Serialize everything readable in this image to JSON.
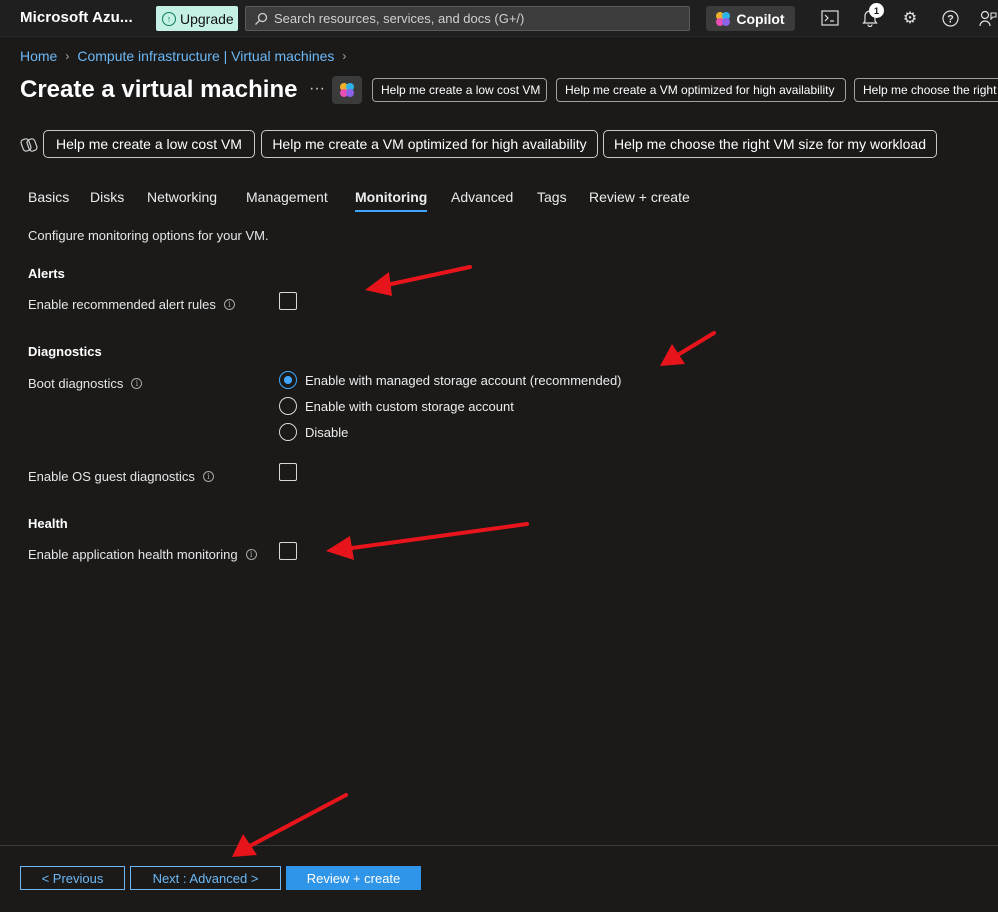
{
  "colors": {
    "background": "#1b1a19",
    "topbar": "#1f1f1f",
    "link": "#6cb8f6",
    "accent": "#3ea6ff",
    "primary_button": "#2f95e8",
    "upgrade_bg": "#c5f0e6",
    "annotation_arrow": "#e8141b"
  },
  "topbar": {
    "brand": "Microsoft Azu...",
    "upgrade_label": "Upgrade",
    "search_placeholder": "Search resources, services, and docs (G+/)",
    "copilot_label": "Copilot",
    "notification_count": "1",
    "icons": [
      "cloud-shell-icon",
      "bell-icon",
      "gear-icon",
      "help-icon",
      "feedback-icon"
    ]
  },
  "breadcrumb": {
    "items": [
      "Home",
      "Compute infrastructure | Virtual machines"
    ]
  },
  "page": {
    "title": "Create a virtual machine",
    "more": "···",
    "chips": [
      "Help me create a low cost VM",
      "Help me create a VM optimized for high availability",
      "Help me choose the right VM size for my workload"
    ]
  },
  "suggestions": [
    "Help me create a low cost VM",
    "Help me create a VM optimized for high availability",
    "Help me choose the right VM size for my workload"
  ],
  "tabs": [
    {
      "label": "Basics",
      "active": false
    },
    {
      "label": "Disks",
      "active": false
    },
    {
      "label": "Networking",
      "active": false
    },
    {
      "label": "Management",
      "active": false
    },
    {
      "label": "Monitoring",
      "active": true
    },
    {
      "label": "Advanced",
      "active": false
    },
    {
      "label": "Tags",
      "active": false
    },
    {
      "label": "Review + create",
      "active": false
    }
  ],
  "content": {
    "description": "Configure monitoring options for your VM.",
    "alerts": {
      "heading": "Alerts",
      "recommended_alert_rules": {
        "label": "Enable recommended alert rules",
        "checked": false
      }
    },
    "diagnostics": {
      "heading": "Diagnostics",
      "boot_label": "Boot diagnostics",
      "boot_options": [
        {
          "label": "Enable with managed storage account (recommended)",
          "selected": true
        },
        {
          "label": "Enable with custom storage account",
          "selected": false
        },
        {
          "label": "Disable",
          "selected": false
        }
      ],
      "os_guest": {
        "label": "Enable OS guest diagnostics",
        "checked": false
      }
    },
    "health": {
      "heading": "Health",
      "app_health": {
        "label": "Enable application health monitoring",
        "checked": false
      }
    }
  },
  "footer": {
    "previous_label": "< Previous",
    "next_label": "Next : Advanced >",
    "review_label": "Review + create"
  }
}
